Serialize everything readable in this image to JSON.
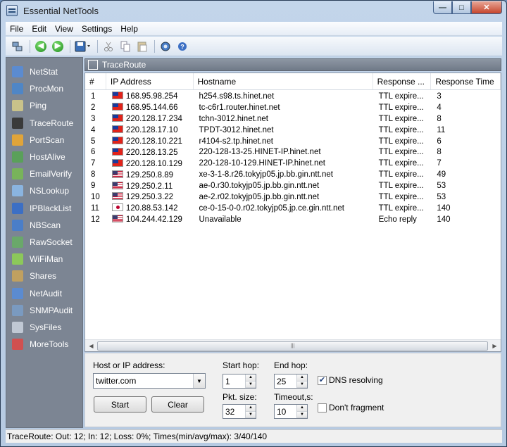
{
  "window": {
    "title": "Essential NetTools",
    "buttons": [
      "minimize",
      "maximize",
      "close"
    ]
  },
  "menu": [
    "File",
    "Edit",
    "View",
    "Settings",
    "Help"
  ],
  "toolbar": {
    "icons": [
      "network-icon",
      "back-icon",
      "forward-icon",
      "save-icon",
      "cut-icon",
      "copy-icon",
      "paste-icon",
      "settings-icon",
      "help-icon"
    ]
  },
  "sidebar": {
    "items": [
      {
        "label": "NetStat",
        "color": "#5b8bd0"
      },
      {
        "label": "ProcMon",
        "color": "#4f86c6"
      },
      {
        "label": "Ping",
        "color": "#c9c28a"
      },
      {
        "label": "TraceRoute",
        "color": "#3a3a3a",
        "active": true
      },
      {
        "label": "PortScan",
        "color": "#e0a43a"
      },
      {
        "label": "HostAlive",
        "color": "#5aa05a"
      },
      {
        "label": "EmailVerify",
        "color": "#78b35a"
      },
      {
        "label": "NSLookup",
        "color": "#8ab4e0"
      },
      {
        "label": "IPBlackList",
        "color": "#3c6fc4"
      },
      {
        "label": "NBScan",
        "color": "#4a7ec8"
      },
      {
        "label": "RawSocket",
        "color": "#6aa86a"
      },
      {
        "label": "WiFiMan",
        "color": "#8cc85a"
      },
      {
        "label": "Shares",
        "color": "#c0a060"
      },
      {
        "label": "NetAudit",
        "color": "#5b8bd0"
      },
      {
        "label": "SNMPAudit",
        "color": "#7a9ac0"
      },
      {
        "label": "SysFiles",
        "color": "#c0c8d4"
      },
      {
        "label": "MoreTools",
        "color": "#d05050"
      }
    ]
  },
  "content": {
    "title": "TraceRoute",
    "columns": [
      "#",
      "IP Address",
      "Hostname",
      "Response ...",
      "Response Time"
    ],
    "rows": [
      {
        "n": "1",
        "flag": "tw",
        "ip": "168.95.98.254",
        "host": "h254.s98.ts.hinet.net",
        "resp": "TTL expire...",
        "time": "3"
      },
      {
        "n": "2",
        "flag": "tw",
        "ip": "168.95.144.66",
        "host": "tc-c6r1.router.hinet.net",
        "resp": "TTL expire...",
        "time": "4"
      },
      {
        "n": "3",
        "flag": "tw",
        "ip": "220.128.17.234",
        "host": "tchn-3012.hinet.net",
        "resp": "TTL expire...",
        "time": "8"
      },
      {
        "n": "4",
        "flag": "tw",
        "ip": "220.128.17.10",
        "host": "TPDT-3012.hinet.net",
        "resp": "TTL expire...",
        "time": "11"
      },
      {
        "n": "5",
        "flag": "tw",
        "ip": "220.128.10.221",
        "host": "r4104-s2.tp.hinet.net",
        "resp": "TTL expire...",
        "time": "6"
      },
      {
        "n": "6",
        "flag": "tw",
        "ip": "220.128.13.25",
        "host": "220-128-13-25.HINET-IP.hinet.net",
        "resp": "TTL expire...",
        "time": "8"
      },
      {
        "n": "7",
        "flag": "tw",
        "ip": "220.128.10.129",
        "host": "220-128-10-129.HINET-IP.hinet.net",
        "resp": "TTL expire...",
        "time": "7"
      },
      {
        "n": "8",
        "flag": "us",
        "ip": "129.250.8.89",
        "host": "xe-3-1-8.r26.tokyjp05.jp.bb.gin.ntt.net",
        "resp": "TTL expire...",
        "time": "49"
      },
      {
        "n": "9",
        "flag": "us",
        "ip": "129.250.2.11",
        "host": "ae-0.r30.tokyjp05.jp.bb.gin.ntt.net",
        "resp": "TTL expire...",
        "time": "53"
      },
      {
        "n": "10",
        "flag": "us",
        "ip": "129.250.3.22",
        "host": "ae-2.r02.tokyjp05.jp.bb.gin.ntt.net",
        "resp": "TTL expire...",
        "time": "53"
      },
      {
        "n": "11",
        "flag": "jp",
        "ip": "120.88.53.142",
        "host": "ce-0-15-0-0.r02.tokyjp05.jp.ce.gin.ntt.net",
        "resp": "TTL expire...",
        "time": "140"
      },
      {
        "n": "12",
        "flag": "us",
        "ip": "104.244.42.129",
        "host": "Unavailable",
        "resp": "Echo reply",
        "time": "140"
      }
    ]
  },
  "form": {
    "host_label": "Host or IP address:",
    "host_value": "twitter.com",
    "start_hop_label": "Start hop:",
    "start_hop_value": "1",
    "end_hop_label": "End hop:",
    "end_hop_value": "25",
    "pkt_size_label": "Pkt. size:",
    "pkt_size_value": "32",
    "timeout_label": "Timeout,s:",
    "timeout_value": "10",
    "dns_label": "DNS resolving",
    "dns_checked": true,
    "frag_label": "Don't fragment",
    "frag_checked": false,
    "start_btn": "Start",
    "clear_btn": "Clear"
  },
  "status": "TraceRoute: Out: 12; In: 12; Loss: 0%; Times(min/avg/max): 3/40/140"
}
